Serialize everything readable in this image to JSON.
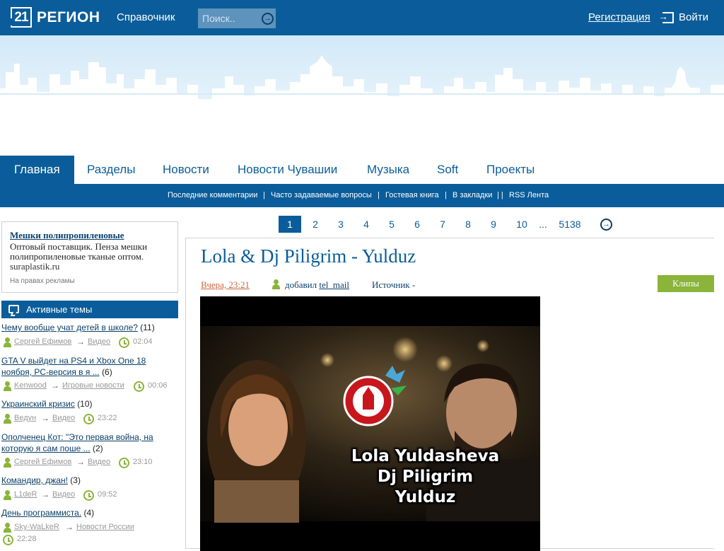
{
  "header": {
    "logo_number": "21",
    "logo_text": "РЕГИОН",
    "directory_link": "Справочник",
    "search_placeholder": "Поиск..",
    "search_button_icon": "arrow-right-circle-icon",
    "register_link": "Регистрация",
    "login_link": "Войти",
    "login_icon": "sign-in-icon",
    "bar_color": "#0a5d9a"
  },
  "main_nav": {
    "items": [
      {
        "label": "Главная",
        "active": true
      },
      {
        "label": "Разделы"
      },
      {
        "label": "Новости"
      },
      {
        "label": "Новости Чувашии"
      },
      {
        "label": "Музыка"
      },
      {
        "label": "Soft"
      },
      {
        "label": "Проекты"
      }
    ]
  },
  "sub_nav": {
    "items": [
      {
        "label": "Последние комментарии"
      },
      {
        "label": "Часто задаваемые вопросы"
      },
      {
        "label": "Гостевая книга"
      },
      {
        "label": "В закладки"
      },
      {
        "label": "RSS Лента"
      }
    ],
    "separators": [
      "|",
      "|",
      "|",
      "| |"
    ]
  },
  "ad": {
    "title": "Мешки полипропиленовые",
    "text": "Оптовый поставщик. Пенза мешки полипропиленовые тканые оптом.",
    "url": "suraplastik.ru",
    "note": "На правах рекламы"
  },
  "active_topics": {
    "heading": "Активные темы",
    "icon": "chat-bubble-icon",
    "items": [
      {
        "title": "Чему вообще учат детей в школе?",
        "count": "(11)",
        "user": "Сергей Ефимов",
        "section": "Видео",
        "time": "02:04"
      },
      {
        "title": "GTA V выйдет на PS4 и Xbox One 18 ноября, PC-версия в я ...",
        "count": "(6)",
        "user": "Kenwood",
        "section": "Игровые новости",
        "time": "00:06"
      },
      {
        "title": "Украинский кризис",
        "count": "(10)",
        "user": "Ведун",
        "section": "Видео",
        "time": "23:22"
      },
      {
        "title": "Ополченец Кот: \"Это первая война, на которую я сам поше ...",
        "count": "(2)",
        "user": "Сергей Ефимов",
        "section": "Видео",
        "time": "23:10"
      },
      {
        "title": "Командир, джан!",
        "count": "(3)",
        "user": "L1deR",
        "section": "Видео",
        "time": "09:52"
      },
      {
        "title": "День программиста.",
        "count": "(4)",
        "user": "Sky-WaLkeR",
        "section": "Новости России",
        "time": "22:28"
      }
    ],
    "arrow": "→"
  },
  "pagination": {
    "current": "1",
    "pages": [
      "2",
      "3",
      "4",
      "5",
      "6",
      "7",
      "8",
      "9",
      "10"
    ],
    "ellipsis": "...",
    "last": "5138",
    "next_icon": "arrow-right-circle-icon"
  },
  "article": {
    "title": "Lola & Dj Piligrim - Yulduz",
    "date": "Вчера, 23:21",
    "added_by_label": "добавил",
    "added_by_user": "tel_mail",
    "source": "Источник -",
    "category_badge": "Клипы",
    "badge_color": "#8ab43a",
    "video_caption": [
      "Lola Yuldasheva",
      "Dj Piligrim",
      "Yulduz"
    ]
  }
}
